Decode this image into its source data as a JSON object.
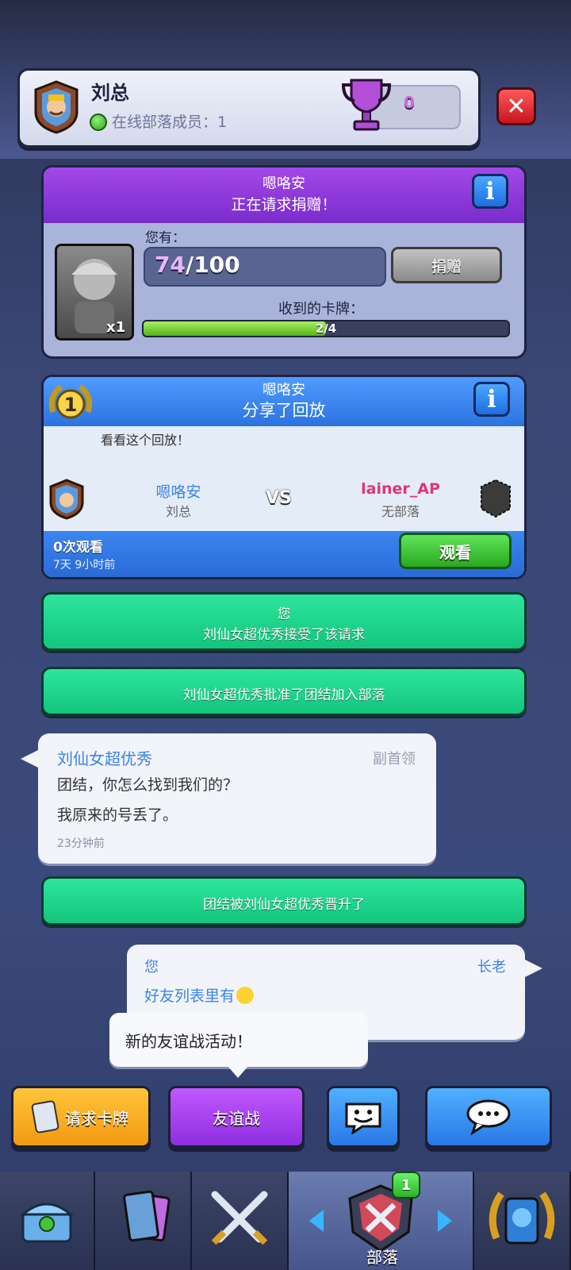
{
  "header": {
    "clan_name": "刘总",
    "online_members": "在线部落成员：1",
    "trophies": "0"
  },
  "donation": {
    "requester": "嗯咯安",
    "request_text": "正在请求捐赠！",
    "you_have_label": "您有：",
    "have_current": "74",
    "have_max": "/100",
    "donate_label": "捐赠",
    "card_count": "x1",
    "received_label": "收到的卡牌：",
    "received_text": "2/4",
    "received_fraction": 0.5
  },
  "replay": {
    "sharer": "嗯咯安",
    "title": "分享了回放",
    "rank": "1",
    "message": "看看这个回放！",
    "player1_name": "嗯咯安",
    "player1_clan": "刘总",
    "vs": "VS",
    "player2_name": "lainer_AP",
    "player2_clan": "无部落",
    "views": "0次观看",
    "time": "7天 9小时前",
    "watch_label": "观看"
  },
  "system_messages": {
    "accepted_line1": "您",
    "accepted_line2": "刘仙女超优秀接受了该请求",
    "approved": "刘仙女超优秀批准了团结加入部落",
    "promoted": "团结被刘仙女超优秀晋升了"
  },
  "chat1": {
    "name": "刘仙女超优秀",
    "role": "副首领",
    "line1": "团结，你怎么找到我们的？",
    "line2": "我原来的号丢了。",
    "time": "23分钟前"
  },
  "chat2": {
    "name": "您",
    "role": "长老",
    "line1": "好友列表里有"
  },
  "tooltip": {
    "text": "新的友谊战活动！"
  },
  "actions": {
    "request_cards": "请求卡牌",
    "friendly_battle": "友谊战"
  },
  "nav": {
    "active_label": "部落",
    "badge": "1"
  }
}
